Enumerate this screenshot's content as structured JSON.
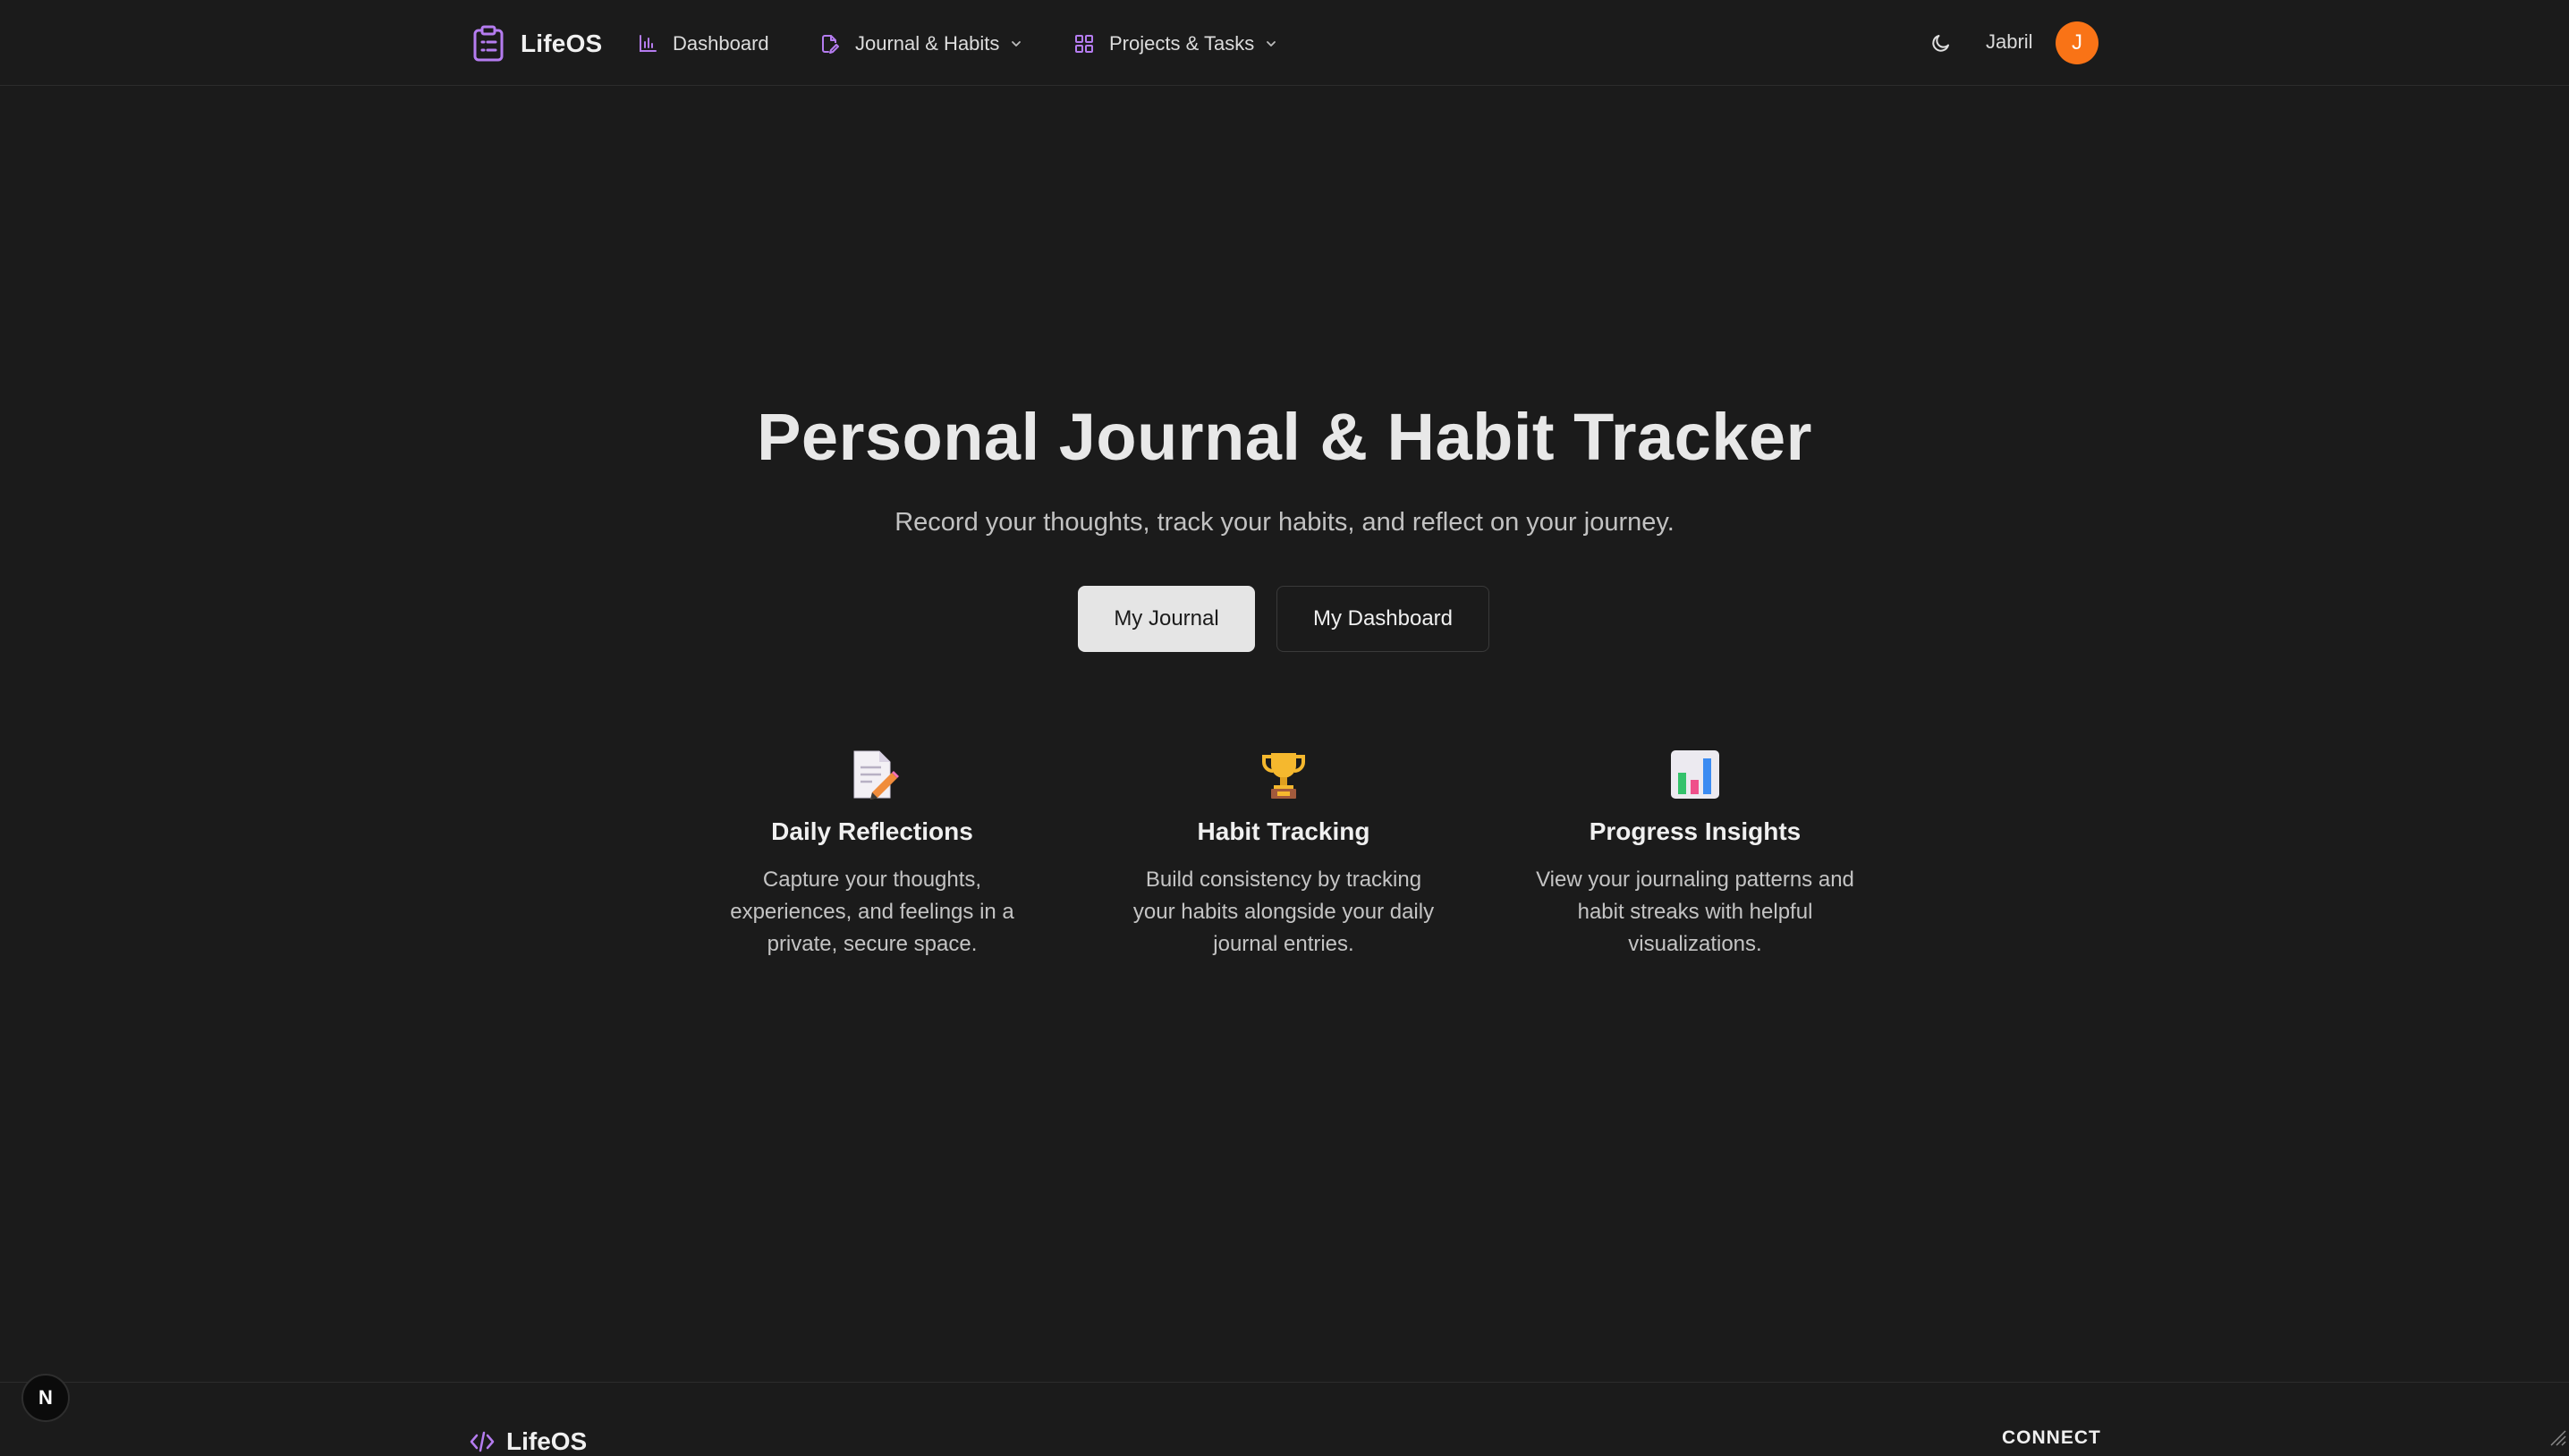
{
  "header": {
    "brand": "LifeOS",
    "nav": {
      "dashboard": "Dashboard",
      "journal_habits": "Journal & Habits",
      "projects_tasks": "Projects & Tasks"
    },
    "user_name": "Jabril",
    "avatar_initial": "J"
  },
  "hero": {
    "title": "Personal Journal & Habit Tracker",
    "subtitle": "Record your thoughts, track your habits, and reflect on your journey.",
    "primary_button": "My Journal",
    "secondary_button": "My Dashboard"
  },
  "features": [
    {
      "icon": "memo-icon",
      "title": "Daily Reflections",
      "description": "Capture your thoughts, experiences, and feelings in a private, secure space."
    },
    {
      "icon": "trophy-icon",
      "title": "Habit Tracking",
      "description": "Build consistency by tracking your habits alongside your daily journal entries."
    },
    {
      "icon": "bar-chart-icon",
      "title": "Progress Insights",
      "description": "View your journaling patterns and habit streaks with helpful visualizations."
    }
  ],
  "footer": {
    "brand": "LifeOS",
    "connect_heading": "CONNECT"
  },
  "dev_badge": "N",
  "colors": {
    "background": "#1b1b1b",
    "accent": "#b57cf0",
    "avatar": "#f97316",
    "primary_button": "#e5e5e5"
  }
}
